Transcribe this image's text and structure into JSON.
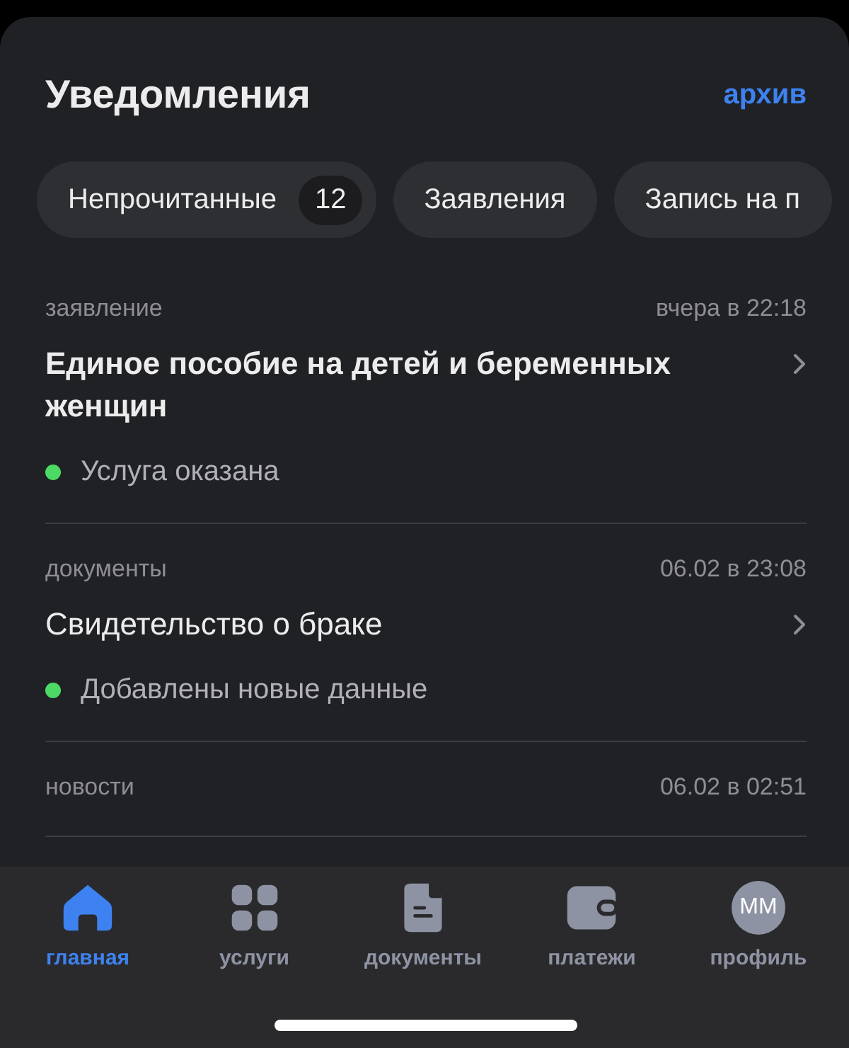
{
  "header": {
    "title": "Уведомления",
    "archive_link": "архив"
  },
  "filters": [
    {
      "label": "Непрочитанные",
      "count": "12"
    },
    {
      "label": "Заявления"
    },
    {
      "label": "Запись на п"
    }
  ],
  "notifications": [
    {
      "category": "заявление",
      "time": "вчера в 22:18",
      "title": "Единое пособие на детей и беременных женщин",
      "unread": true,
      "status": "Услуга оказана",
      "color": "#4cd964"
    },
    {
      "category": "документы",
      "time": "06.02 в 23:08",
      "title": "Свидетельство о браке",
      "unread": false,
      "status": "Добавлены новые данные",
      "color": "#4cd964"
    },
    {
      "category": "новости",
      "time": "06.02 в 02:51"
    }
  ],
  "tab_bar": [
    {
      "kind": "home",
      "label": "главная",
      "selected": true
    },
    {
      "kind": "grid",
      "label": "услуги",
      "selected": false
    },
    {
      "kind": "document",
      "label": "документы",
      "selected": false
    },
    {
      "kind": "wallet",
      "label": "платежи",
      "selected": false
    },
    {
      "kind": "avatar",
      "label": "профиль",
      "initials": "ММ",
      "selected": false
    }
  ]
}
